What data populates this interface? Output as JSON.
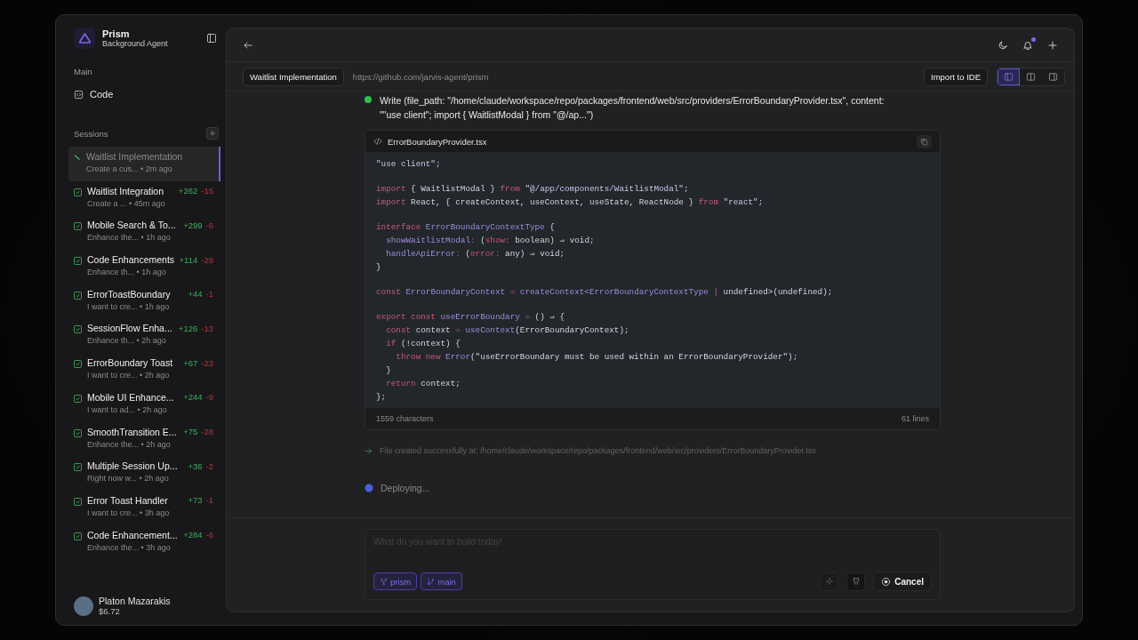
{
  "sidebar": {
    "app_name": "Prism",
    "app_subtitle": "Background Agent",
    "main_label": "Main",
    "nav_items": [
      {
        "label": "Code",
        "selected": false
      }
    ],
    "sessions_label": "Sessions",
    "sessions": [
      {
        "title": "Waitlist Implementation",
        "meta": "Create a cus... • 2m ago",
        "kind": "running",
        "selected": true
      },
      {
        "title": "Waitlist Integration",
        "meta": "Create a ... • 45m ago",
        "added": "+262",
        "removed": "-15",
        "kind": "done",
        "selected": false
      },
      {
        "title": "Mobile Search & To...",
        "meta": "Enhance the... • 1h ago",
        "added": "+299",
        "removed": "-6",
        "kind": "done",
        "selected": false
      },
      {
        "title": "Code Enhancements",
        "meta": "Enhance th... • 1h ago",
        "added": "+114",
        "removed": "-29",
        "kind": "done",
        "selected": false
      },
      {
        "title": "ErrorToastBoundary",
        "meta": "I want to cre... • 1h ago",
        "added": "+44",
        "removed": "-1",
        "kind": "done",
        "selected": false
      },
      {
        "title": "SessionFlow Enha...",
        "meta": "Enhance th... • 2h ago",
        "added": "+126",
        "removed": "-13",
        "kind": "done",
        "selected": false
      },
      {
        "title": "ErrorBoundary Toast",
        "meta": "I want to cre... • 2h ago",
        "added": "+67",
        "removed": "-23",
        "kind": "done",
        "selected": false
      },
      {
        "title": "Mobile UI Enhance...",
        "meta": "I want to ad... • 2h ago",
        "added": "+244",
        "removed": "-9",
        "kind": "done",
        "selected": false
      },
      {
        "title": "SmoothTransition E...",
        "meta": "Enhance the... • 2h ago",
        "added": "+75",
        "removed": "-28",
        "kind": "done",
        "selected": false
      },
      {
        "title": "Multiple Session Up...",
        "meta": "Right now w... • 2h ago",
        "added": "+36",
        "removed": "-2",
        "kind": "done",
        "selected": false
      },
      {
        "title": "Error Toast Handler",
        "meta": "I want to cre... • 3h ago",
        "added": "+73",
        "removed": "-1",
        "kind": "done",
        "selected": false
      },
      {
        "title": "Code Enhancement...",
        "meta": "Enhance the... • 3h ago",
        "added": "+284",
        "removed": "-6",
        "kind": "done",
        "selected": false
      }
    ],
    "user": {
      "name": "Platon Mazarakis",
      "balance": "$6.72"
    }
  },
  "header": {
    "notifications_unread": true
  },
  "tab_bar": {
    "session_tab": "Waitlist Implementation",
    "repo_url": "https://github.com/jarvis-agent/prism",
    "import_button": "Import to IDE",
    "layout_modes": [
      {
        "selected": true
      },
      {
        "selected": false
      },
      {
        "selected": false
      }
    ]
  },
  "messages": [
    {
      "kind": "tool_call",
      "succeeded": true,
      "text": "Write (file_path: \"/home/claude/workspace/repo/packages/frontend/web/src/providers/ErrorBoundaryProvider.tsx\", content: \"\"use client\"; import { WaitlistModal } from \"@/ap...\")"
    },
    {
      "kind": "code_file",
      "filename": "ErrorBoundaryProvider.tsx",
      "characters": "1559 characters",
      "lines_count": "61 lines",
      "code": [
        {
          "kind": "code",
          "tokens": [
            {
              "kind": "string",
              "text": "\"use client\";"
            }
          ]
        },
        {
          "kind": "blank"
        },
        {
          "kind": "code",
          "tokens": [
            {
              "kind": "keyword",
              "text": "import"
            },
            {
              "kind": "plain",
              "text": " { WaitlistModal } "
            },
            {
              "kind": "keyword",
              "text": "from"
            },
            {
              "kind": "string",
              "text": " \"@/app/components/WaitlistModal\""
            },
            {
              "kind": "plain",
              "text": ";"
            }
          ]
        },
        {
          "kind": "code",
          "tokens": [
            {
              "kind": "keyword",
              "text": "import"
            },
            {
              "kind": "plain",
              "text": " React, { createContext, useContext, useState, ReactNode } "
            },
            {
              "kind": "keyword",
              "text": "from"
            },
            {
              "kind": "string",
              "text": " \"react\""
            },
            {
              "kind": "plain",
              "text": ";"
            }
          ]
        },
        {
          "kind": "blank"
        },
        {
          "kind": "code",
          "tokens": [
            {
              "kind": "keyword",
              "text": "interface"
            },
            {
              "kind": "type",
              "text": " ErrorBoundaryContextType"
            },
            {
              "kind": "plain",
              "text": " {"
            }
          ]
        },
        {
          "kind": "code",
          "tokens": [
            {
              "kind": "type",
              "text": "  showWaitlistModal"
            },
            {
              "kind": "keyword",
              "text": ":"
            },
            {
              "kind": "plain",
              "text": " ("
            },
            {
              "kind": "param",
              "text": "show"
            },
            {
              "kind": "keyword",
              "text": ":"
            },
            {
              "kind": "plain",
              "text": " boolean) ⇒ void;"
            }
          ]
        },
        {
          "kind": "code",
          "tokens": [
            {
              "kind": "type",
              "text": "  handleApiError"
            },
            {
              "kind": "keyword",
              "text": ":"
            },
            {
              "kind": "plain",
              "text": " ("
            },
            {
              "kind": "param",
              "text": "error"
            },
            {
              "kind": "keyword",
              "text": ":"
            },
            {
              "kind": "plain",
              "text": " any) ⇒ void;"
            }
          ]
        },
        {
          "kind": "code",
          "tokens": [
            {
              "kind": "plain",
              "text": "}"
            }
          ]
        },
        {
          "kind": "blank"
        },
        {
          "kind": "code",
          "tokens": [
            {
              "kind": "keyword",
              "text": "const"
            },
            {
              "kind": "type",
              "text": " ErrorBoundaryContext"
            },
            {
              "kind": "keyword",
              "text": " ="
            },
            {
              "kind": "type",
              "text": " createContext<ErrorBoundaryContextType"
            },
            {
              "kind": "keyword",
              "text": " |"
            },
            {
              "kind": "plain",
              "text": " undefined>(undefined);"
            }
          ]
        },
        {
          "kind": "blank"
        },
        {
          "kind": "code",
          "tokens": [
            {
              "kind": "keyword",
              "text": "export const"
            },
            {
              "kind": "type",
              "text": " useErrorBoundary"
            },
            {
              "kind": "keyword",
              "text": " ="
            },
            {
              "kind": "plain",
              "text": " () ⇒ {"
            }
          ]
        },
        {
          "kind": "code",
          "tokens": [
            {
              "kind": "keyword",
              "text": "  const"
            },
            {
              "kind": "plain",
              "text": " context "
            },
            {
              "kind": "keyword",
              "text": "="
            },
            {
              "kind": "type",
              "text": " useContext"
            },
            {
              "kind": "plain",
              "text": "(ErrorBoundaryContext);"
            }
          ]
        },
        {
          "kind": "code",
          "tokens": [
            {
              "kind": "keyword",
              "text": "  if"
            },
            {
              "kind": "plain",
              "text": " (!context) {"
            }
          ]
        },
        {
          "kind": "code",
          "tokens": [
            {
              "kind": "keyword",
              "text": "    throw new"
            },
            {
              "kind": "type",
              "text": " Error"
            },
            {
              "kind": "plain",
              "text": "(\"useErrorBoundary must be used within an ErrorBoundaryProvider\");"
            }
          ]
        },
        {
          "kind": "code",
          "tokens": [
            {
              "kind": "plain",
              "text": "  }"
            }
          ]
        },
        {
          "kind": "code",
          "tokens": [
            {
              "kind": "keyword",
              "text": "  return"
            },
            {
              "kind": "plain",
              "text": " context;"
            }
          ]
        },
        {
          "kind": "code",
          "tokens": [
            {
              "kind": "plain",
              "text": "};"
            }
          ]
        }
      ]
    },
    {
      "kind": "result",
      "text": "File created successfully at: /home/claude/workspace/repo/packages/frontend/web/src/providers/ErrorBoundaryProvider.tsx"
    },
    {
      "kind": "progress",
      "text": "Deploying..."
    }
  ],
  "composer": {
    "placeholder": "What do you want to build today!",
    "chips": [
      {
        "kind": "repo",
        "label": "prism"
      },
      {
        "kind": "branch",
        "label": "main"
      }
    ],
    "cancel_button": "Cancel"
  }
}
